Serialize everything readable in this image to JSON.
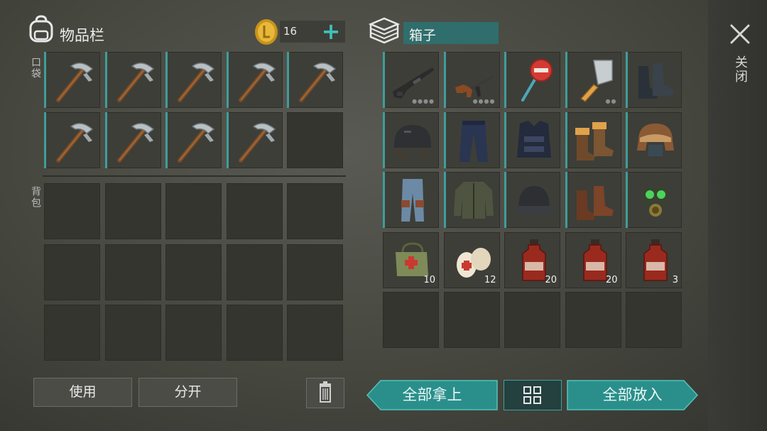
{
  "inventory": {
    "title": "物品栏",
    "coins": "16",
    "pocket_label": "口袋",
    "backpack_label": "背包",
    "pocket_slots": [
      {
        "item": "pickaxe-icon"
      },
      {
        "item": "pickaxe-icon"
      },
      {
        "item": "pickaxe-icon"
      },
      {
        "item": "pickaxe-icon"
      },
      {
        "item": "pickaxe-icon"
      },
      {
        "item": "pickaxe-icon"
      },
      {
        "item": "pickaxe-icon"
      },
      {
        "item": "pickaxe-icon"
      },
      {
        "item": "pickaxe-icon"
      },
      {
        "item": ""
      }
    ],
    "backpack_rows": 3,
    "backpack_cols": 5
  },
  "box": {
    "title": "箱子",
    "slots": [
      {
        "item": "shotgun-icon",
        "qty": "",
        "dots": "●●●●"
      },
      {
        "item": "assault-rifle-icon",
        "qty": "",
        "dots": "●●●●"
      },
      {
        "item": "stop-sign-icon",
        "qty": "",
        "dots": ""
      },
      {
        "item": "cleaver-icon",
        "qty": "",
        "dots": "●●"
      },
      {
        "item": "boots-icon",
        "qty": "",
        "dots": ""
      },
      {
        "item": "helmet-icon",
        "qty": "",
        "dots": ""
      },
      {
        "item": "police-pants-icon",
        "qty": "",
        "dots": ""
      },
      {
        "item": "police-vest-icon",
        "qty": "",
        "dots": ""
      },
      {
        "item": "fur-boots-icon",
        "qty": "",
        "dots": ""
      },
      {
        "item": "fur-hat-icon",
        "qty": "",
        "dots": ""
      },
      {
        "item": "jeans-icon",
        "qty": "",
        "dots": ""
      },
      {
        "item": "jacket-icon",
        "qty": "",
        "dots": ""
      },
      {
        "item": "beanie-icon",
        "qty": "",
        "dots": ""
      },
      {
        "item": "leather-boots-icon",
        "qty": "",
        "dots": ""
      },
      {
        "item": "gas-mask-icon",
        "qty": "",
        "dots": ""
      },
      {
        "item": "medkit-icon",
        "qty": "10",
        "dots": ""
      },
      {
        "item": "bandage-icon",
        "qty": "12",
        "dots": ""
      },
      {
        "item": "spirit-bottle-icon",
        "qty": "20",
        "dots": ""
      },
      {
        "item": "spirit-bottle-icon",
        "qty": "20",
        "dots": ""
      },
      {
        "item": "spirit-bottle-icon",
        "qty": "3",
        "dots": ""
      }
    ]
  },
  "buttons": {
    "use": "使用",
    "split": "分开",
    "take_all": "全部拿上",
    "put_all": "全部放入",
    "close": "关闭"
  },
  "colors": {
    "accent": "#3f9d9a",
    "teal_button": "#2a8f8b"
  }
}
